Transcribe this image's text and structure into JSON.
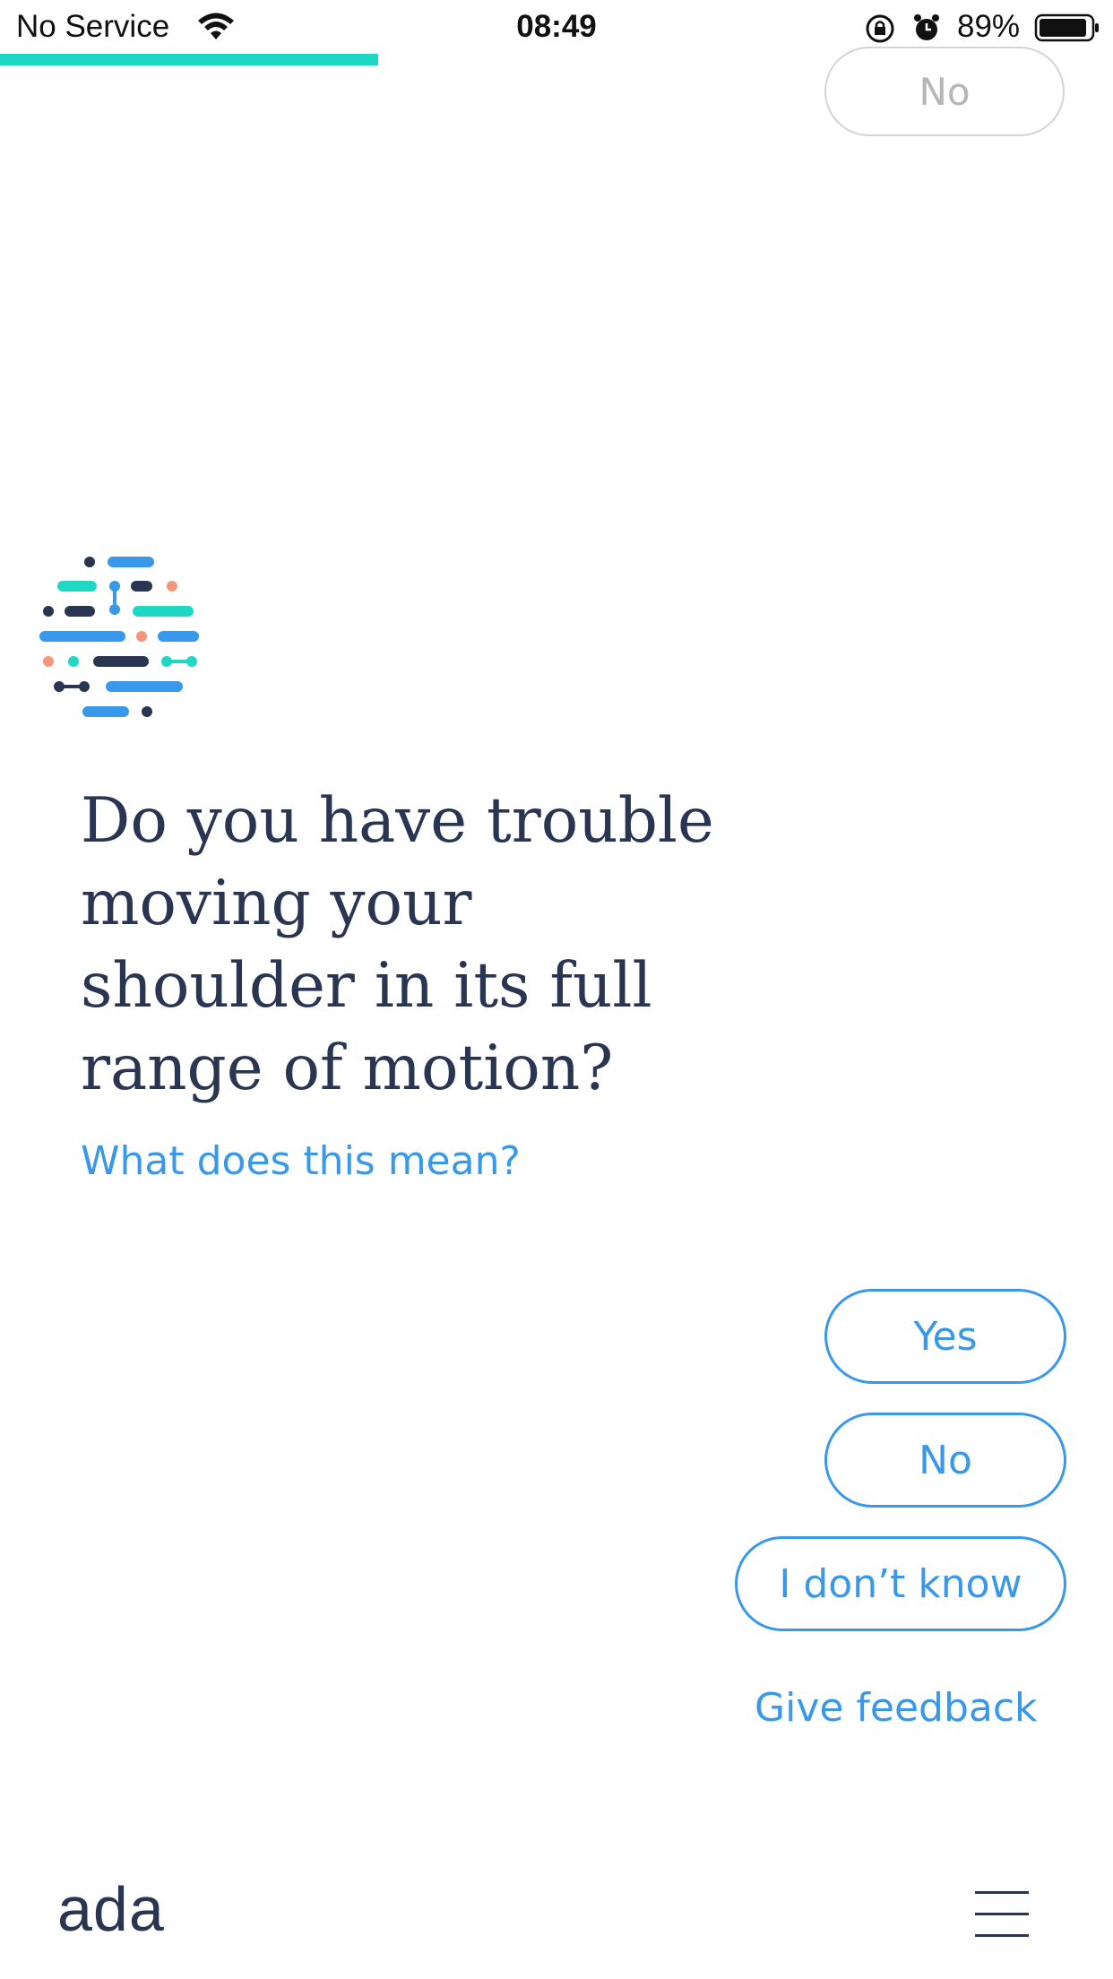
{
  "status_bar": {
    "carrier": "No Service",
    "time": "08:49",
    "battery_percent": "89%"
  },
  "progress": {
    "fraction": 0.34,
    "color": "#1fd8c4"
  },
  "previous_answer": {
    "label": "No"
  },
  "question": {
    "text": "Do you have trouble moving your shoulder in its full range of motion?",
    "explain_link": "What does this mean?"
  },
  "answers": [
    {
      "label": "Yes"
    },
    {
      "label": "No"
    },
    {
      "label": "I don’t know"
    }
  ],
  "feedback_link": "Give feedback",
  "footer": {
    "logo_text": "ada",
    "menu_icon": "hamburger-menu-icon"
  },
  "colors": {
    "accent": "#3a98ea",
    "text_dark": "#2a3552",
    "teal": "#1fd8c4",
    "salmon": "#f4967a"
  }
}
